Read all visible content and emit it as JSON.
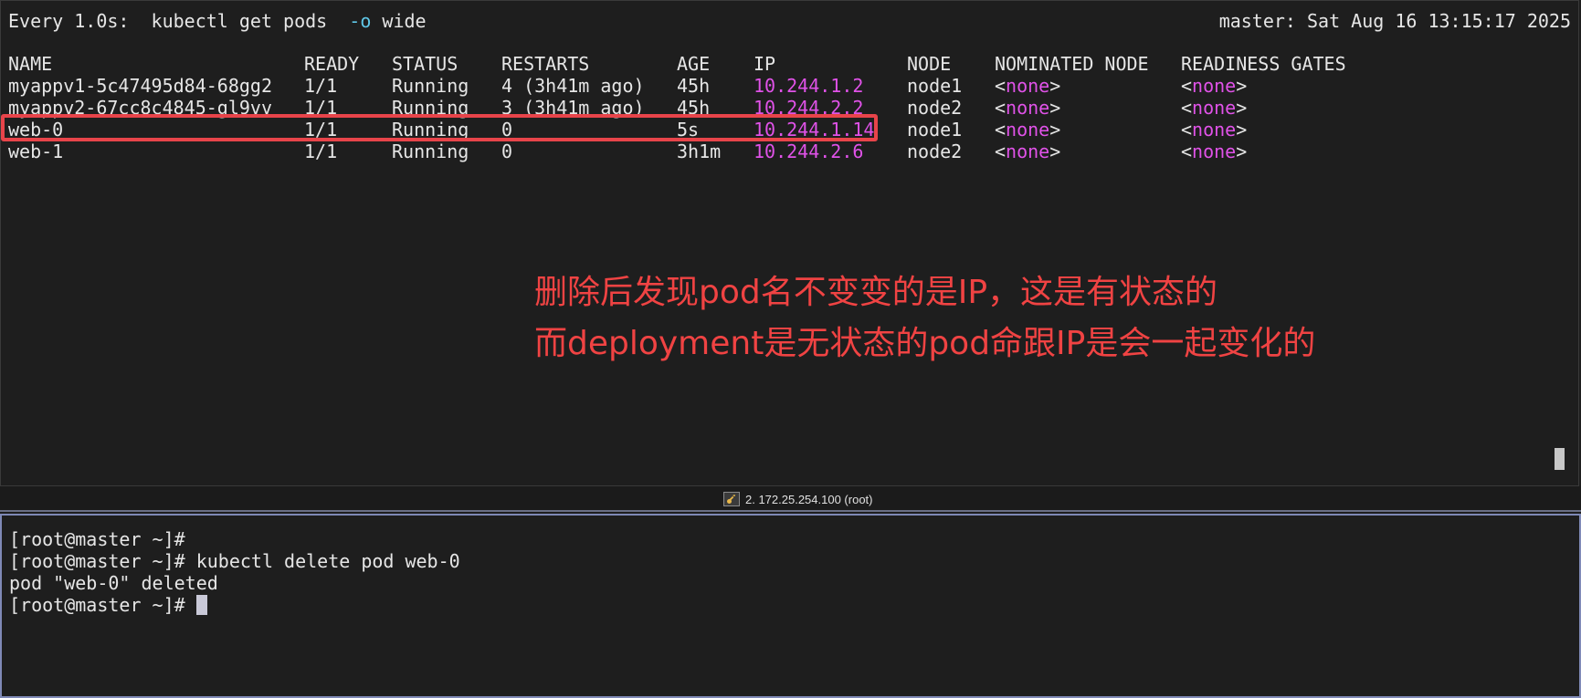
{
  "watch": {
    "header_prefix": "Every 1.0s:  kubectl get pods  ",
    "header_flag": "-o",
    "header_suffix": " wide",
    "host_time": "master: Sat Aug 16 13:15:17 2025"
  },
  "table": {
    "headers": [
      "NAME",
      "READY",
      "STATUS",
      "RESTARTS",
      "AGE",
      "IP",
      "NODE",
      "NOMINATED NODE",
      "READINESS GATES"
    ],
    "rows": [
      {
        "name": "myappv1-5c47495d84-68gg2",
        "ready": "1/1",
        "status": "Running",
        "restarts": "4 (3h41m ago)",
        "age": "45h",
        "ip": "10.244.1.2",
        "node": "node1",
        "nominated_node": "none",
        "readiness_gates": "none"
      },
      {
        "name": "myappv2-67cc8c4845-gl9vv",
        "ready": "1/1",
        "status": "Running",
        "restarts": "3 (3h41m ago)",
        "age": "45h",
        "ip": "10.244.2.2",
        "node": "node2",
        "nominated_node": "none",
        "readiness_gates": "none"
      },
      {
        "name": "web-0",
        "ready": "1/1",
        "status": "Running",
        "restarts": "0",
        "age": "5s",
        "ip": "10.244.1.14",
        "node": "node1",
        "nominated_node": "none",
        "readiness_gates": "none"
      },
      {
        "name": "web-1",
        "ready": "1/1",
        "status": "Running",
        "restarts": "0",
        "age": "3h1m",
        "ip": "10.244.2.6",
        "node": "node2",
        "nominated_node": "none",
        "readiness_gates": "none"
      }
    ]
  },
  "annotation": {
    "line1": "删除后发现pod名不变变的是IP，这是有状态的",
    "line2": "而deployment是无状态的pod命跟IP是会一起变化的"
  },
  "status_bar": {
    "session_label": "2. 172.25.254.100 (root)",
    "icon": "key-icon"
  },
  "shell": {
    "prompt": "[root@master ~]#",
    "lines": [
      {
        "prompt": "[root@master ~]#",
        "text": ""
      },
      {
        "prompt": "[root@master ~]#",
        "text": " kubectl delete pod web-0"
      },
      {
        "prompt": "",
        "text": "pod \"web-0\" deleted"
      },
      {
        "prompt": "[root@master ~]#",
        "text": " "
      }
    ]
  },
  "colors": {
    "ip": "#e052e8",
    "flag": "#5fc7e7",
    "annotation": "#f04343",
    "highlight_box": "#e8444a"
  }
}
